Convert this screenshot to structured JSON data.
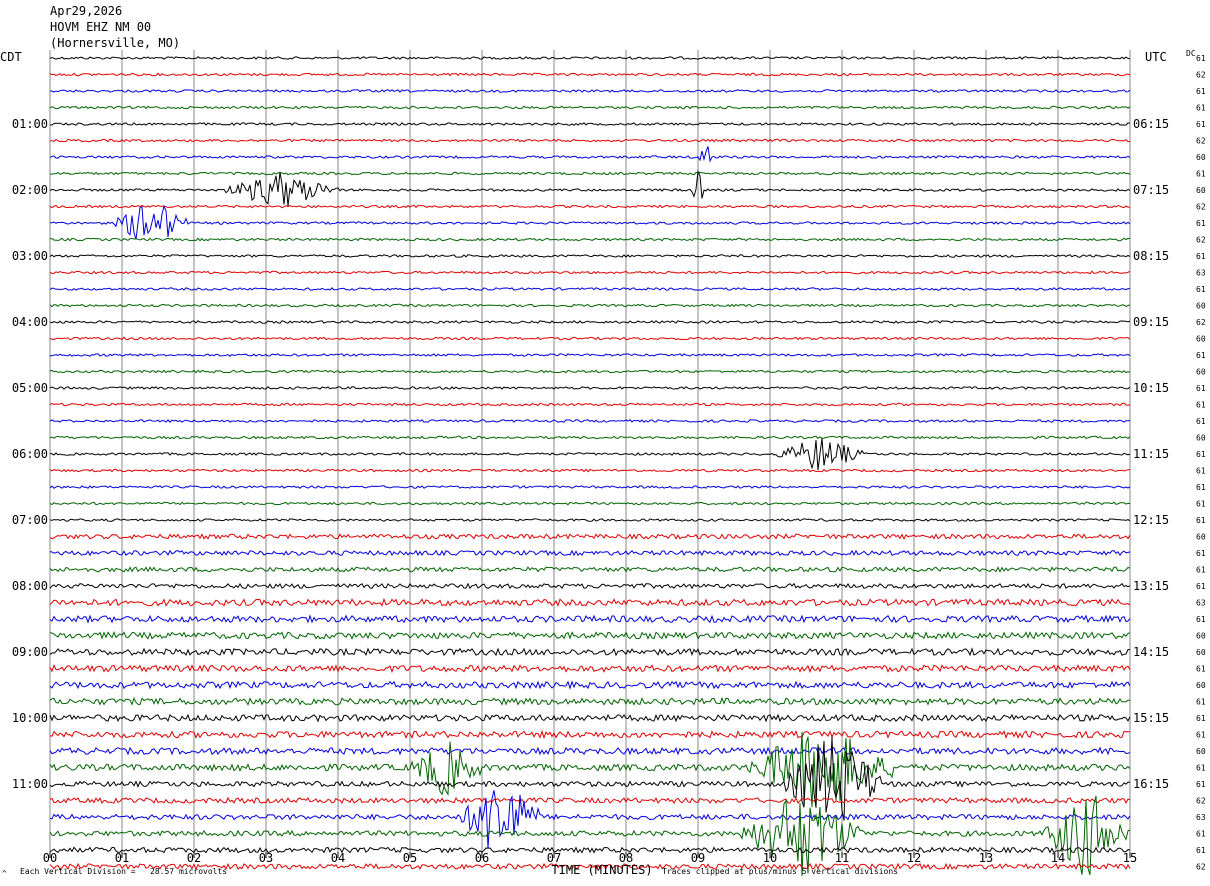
{
  "header": {
    "date": "Apr29,2026",
    "station": "HOVM EHZ NM 00",
    "location": "(Hornersville, MO)"
  },
  "left_zone": "CDT",
  "right_zone": "UTC",
  "dc_label": "DC",
  "footer": {
    "vertical_division": "Each Vertical Division =   28.57 microvolts",
    "clip_note": "Traces clipped at plus/minus 5 vertical divisions",
    "corner_mark": "^"
  },
  "chart_data": {
    "type": "line",
    "title": "",
    "xlabel": "TIME (MINUTES)",
    "ylabel": "",
    "xlim": [
      0,
      15
    ],
    "x_ticks": [
      "00",
      "01",
      "02",
      "03",
      "04",
      "05",
      "06",
      "07",
      "08",
      "09",
      "10",
      "11",
      "12",
      "13",
      "14",
      "15"
    ],
    "grid": "vertical lines each minute",
    "trace_colors": [
      "#000000",
      "#e00000",
      "#0000e0",
      "#006400"
    ],
    "left_time_labels": [
      "01:00",
      "02:00",
      "03:00",
      "04:00",
      "05:00",
      "06:00",
      "07:00",
      "08:00",
      "09:00",
      "10:00",
      "11:00"
    ],
    "right_time_labels": [
      "06:15",
      "07:15",
      "08:15",
      "09:15",
      "10:15",
      "11:15",
      "12:15",
      "13:15",
      "14:15",
      "15:15",
      "16:15"
    ],
    "dc_offsets": [
      61,
      62,
      61,
      61,
      61,
      62,
      60,
      61,
      60,
      62,
      61,
      62,
      61,
      63,
      61,
      60,
      62,
      60,
      61,
      60,
      61,
      61,
      61,
      60,
      61,
      61,
      61,
      61,
      61,
      60,
      61,
      61,
      61,
      63,
      61,
      60,
      60,
      61,
      60,
      61,
      61,
      61,
      60,
      61,
      61,
      62,
      63,
      61,
      61,
      62
    ],
    "events": [
      {
        "trace": 8,
        "start": 2.4,
        "end": 4.0,
        "amplitude": 2.0
      },
      {
        "trace": 10,
        "start": 0.9,
        "end": 1.9,
        "amplitude": 3.0
      },
      {
        "trace": 8,
        "start": 8.9,
        "end": 9.1,
        "amplitude": 2.0
      },
      {
        "trace": 6,
        "start": 9.0,
        "end": 9.2,
        "amplitude": 3.0
      },
      {
        "trace": 24,
        "start": 10.1,
        "end": 11.3,
        "amplitude": 2.0
      },
      {
        "trace": 43,
        "start": 5.0,
        "end": 6.0,
        "amplitude": 3.0
      },
      {
        "trace": 43,
        "start": 9.7,
        "end": 11.7,
        "amplitude": 5.0
      },
      {
        "trace": 44,
        "start": 10.2,
        "end": 11.6,
        "amplitude": 6.0
      },
      {
        "trace": 46,
        "start": 5.7,
        "end": 6.8,
        "amplitude": 5.0
      },
      {
        "trace": 47,
        "start": 9.6,
        "end": 11.3,
        "amplitude": 5.0
      },
      {
        "trace": 47,
        "start": 13.8,
        "end": 15.0,
        "amplitude": 5.0
      }
    ]
  }
}
